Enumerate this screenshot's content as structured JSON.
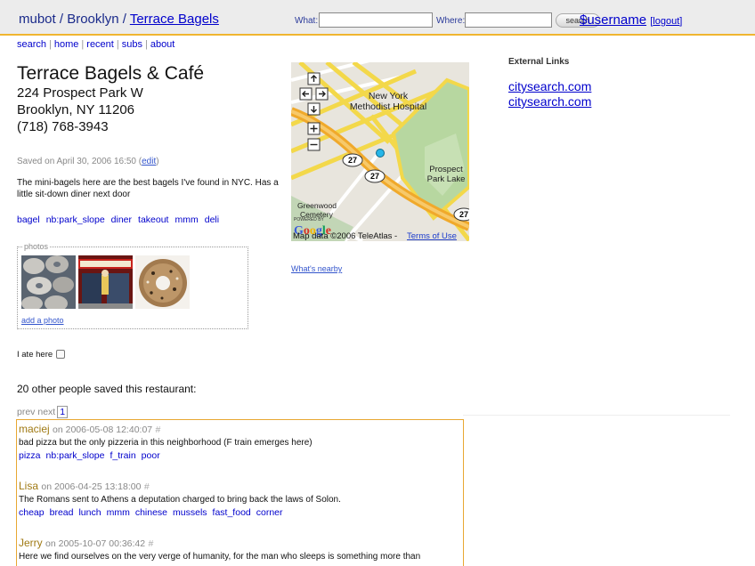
{
  "topbar": {
    "crumbs": [
      {
        "label": "mubot"
      },
      {
        "label": "Brooklyn"
      },
      {
        "label": "Terrace Bagels"
      }
    ],
    "crumb_sep": "/",
    "what_label": "What:",
    "what_value": "",
    "where_label": "Where:",
    "where_value": "",
    "search_button": "search",
    "username": "$username",
    "logout": "logout"
  },
  "nav": [
    "search",
    "home",
    "recent",
    "subs",
    "about"
  ],
  "restaurant": {
    "name": "Terrace Bagels & Café",
    "street": "224 Prospect Park W",
    "city": "Brooklyn, NY 11206",
    "phone": "(718) 768-3943",
    "saved_on": "Saved on April 30, 2006 16:50",
    "edit": "edit",
    "description": "The mini-bagels here are the best bagels I've found in NYC. Has a little sit-down diner next door",
    "tags": [
      "bagel",
      "nb:park_slope",
      "diner",
      "takeout",
      "mmm",
      "deli"
    ]
  },
  "photos": {
    "legend": "photos",
    "add_photo": "add a photo"
  },
  "ate_here": "I ate here",
  "map": {
    "labels": [
      "New York Methodist Hospital",
      "Prospect Park Lake",
      "Greenwood Cemetery",
      "27",
      "27",
      "27"
    ],
    "powered_by": "POWERED BY",
    "copyright": "Map data ©2006 TeleAtlas -",
    "terms": "Terms of Use",
    "whats_nearby": "What's nearby"
  },
  "external": {
    "title": "External Links",
    "links": [
      "citysearch.com",
      "citysearch.com"
    ]
  },
  "others_saved": "20 other people saved this restaurant:",
  "pager": {
    "prev": "prev",
    "next": "next",
    "page": "1"
  },
  "comments": [
    {
      "user": "maciej",
      "date": "on 2006-05-08 12:40:07",
      "text": "bad pizza but the only pizzeria in this neighborhood (F train emerges here)",
      "tags": [
        "pizza",
        "nb:park_slope",
        "f_train",
        "poor"
      ]
    },
    {
      "user": "Lisa",
      "date": "on 2006-04-25 13:18:00",
      "text": "The Romans sent to Athens a deputation charged to bring back the laws of Solon.",
      "tags": [
        "cheap",
        "bread",
        "lunch",
        "mmm",
        "chinese",
        "mussels",
        "fast_food",
        "corner"
      ]
    },
    {
      "user": "Jerry",
      "date": "on 2005-10-07 00:36:42",
      "text": "Here we find ourselves on the very verge of humanity, for the man who sleeps is something more than",
      "tags": []
    }
  ],
  "colors": {
    "link": "#0000cc",
    "accent_border": "#e8a832",
    "user_color": "#a07a14"
  }
}
